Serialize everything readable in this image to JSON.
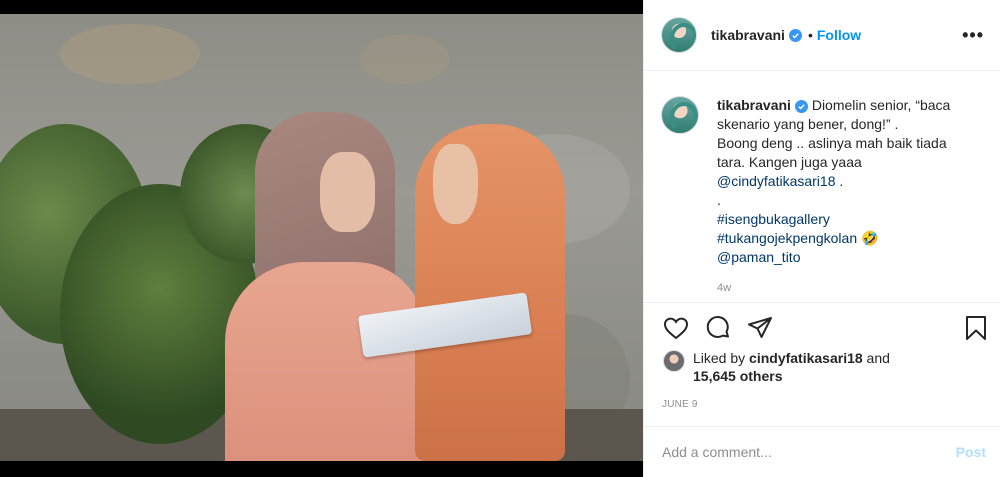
{
  "post": {
    "username": "tikabravani",
    "follow_label": "Follow",
    "more_label": "•••",
    "caption": {
      "text_line1": "Diomelin senior, “baca skenario yang bener, dong!” .",
      "text_line2": "Boong deng .. aslinya mah baik tiada tara. Kangen juga yaaa",
      "mention1": "@cindyfatikasari18",
      "mention1_suffix": " .",
      "dot_line": ".",
      "hashtag1": "#isengbukagallery",
      "hashtag2": "#tukangojekpengkolan",
      "hashtag2_suffix": " 🤣",
      "mention2": "@paman_tito",
      "time": "4w"
    },
    "likes": {
      "prefix": "Liked by ",
      "user": "cindyfatikasari18",
      "middle": " and",
      "count": "15,645 others"
    },
    "date": "JUNE 9",
    "comment_placeholder": "Add a comment...",
    "post_label": "Post"
  },
  "icons": {
    "verified": "verified-badge-icon",
    "like": "heart-icon",
    "comment": "comment-icon",
    "share": "share-icon",
    "save": "bookmark-icon",
    "more": "more-options-icon"
  },
  "colors": {
    "accent": "#0095f6",
    "verified": "#3897f0",
    "muted": "#8e8e8e",
    "post_disabled": "#b2dffc"
  }
}
